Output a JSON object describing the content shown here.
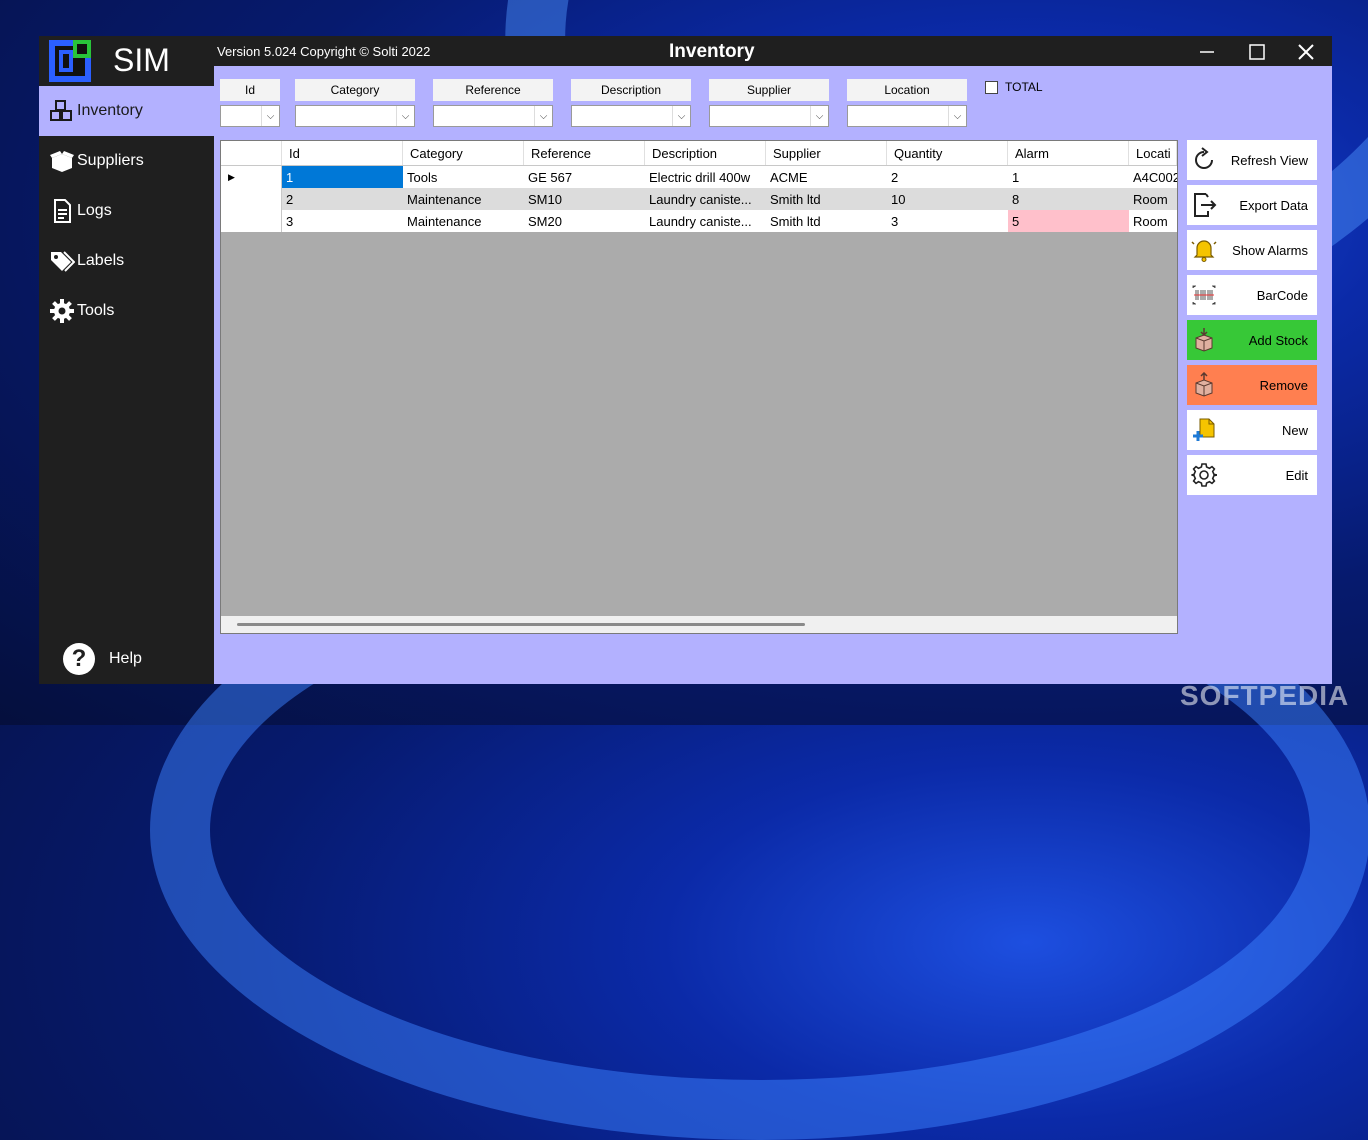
{
  "app": {
    "name": "SIM",
    "version_text": "Version 5.024  Copyright © Solti 2022",
    "window_title": "Inventory"
  },
  "sidebar": {
    "items": [
      {
        "label": "Inventory",
        "icon": "cubes-icon"
      },
      {
        "label": "Suppliers",
        "icon": "box-open-icon"
      },
      {
        "label": "Logs",
        "icon": "document-icon"
      },
      {
        "label": "Labels",
        "icon": "tags-icon"
      },
      {
        "label": "Tools",
        "icon": "gear-icon"
      }
    ],
    "help_label": "Help"
  },
  "filters": {
    "labels": [
      "Id",
      "Category",
      "Reference",
      "Description",
      "Supplier",
      "Location"
    ],
    "total_label": "TOTAL"
  },
  "grid": {
    "columns": [
      "Id",
      "Category",
      "Reference",
      "Description",
      "Supplier",
      "Quantity",
      "Alarm",
      "Locati"
    ],
    "rows": [
      [
        "1",
        "Tools",
        "GE 567",
        "Electric drill 400w",
        "ACME",
        "2",
        "1",
        "A4C002"
      ],
      [
        "2",
        "Maintenance",
        "SM10",
        "Laundry caniste...",
        "Smith ltd",
        "10",
        "8",
        "Room"
      ],
      [
        "3",
        "Maintenance",
        "SM20",
        "Laundry caniste...",
        "Smith ltd",
        "3",
        "5",
        "Room"
      ]
    ]
  },
  "actions": [
    {
      "label": "Refresh View",
      "icon": "refresh-icon"
    },
    {
      "label": "Export Data",
      "icon": "export-icon"
    },
    {
      "label": "Show Alarms",
      "icon": "bell-icon"
    },
    {
      "label": "BarCode",
      "icon": "barcode-icon"
    },
    {
      "label": "Add Stock",
      "icon": "box-in-icon",
      "color": "#37c837"
    },
    {
      "label": "Remove",
      "icon": "box-out-icon",
      "color": "#ff7f50"
    },
    {
      "label": "New",
      "icon": "new-document-icon"
    },
    {
      "label": "Edit",
      "icon": "gear-icon"
    }
  ],
  "colors": {
    "accent": "#b3b1ff",
    "selected_cell": "#0078d7",
    "alarm_cell": "#ffc0cb",
    "alt_row": "#dcdcdc"
  },
  "watermark": "SOFTPEDIA"
}
